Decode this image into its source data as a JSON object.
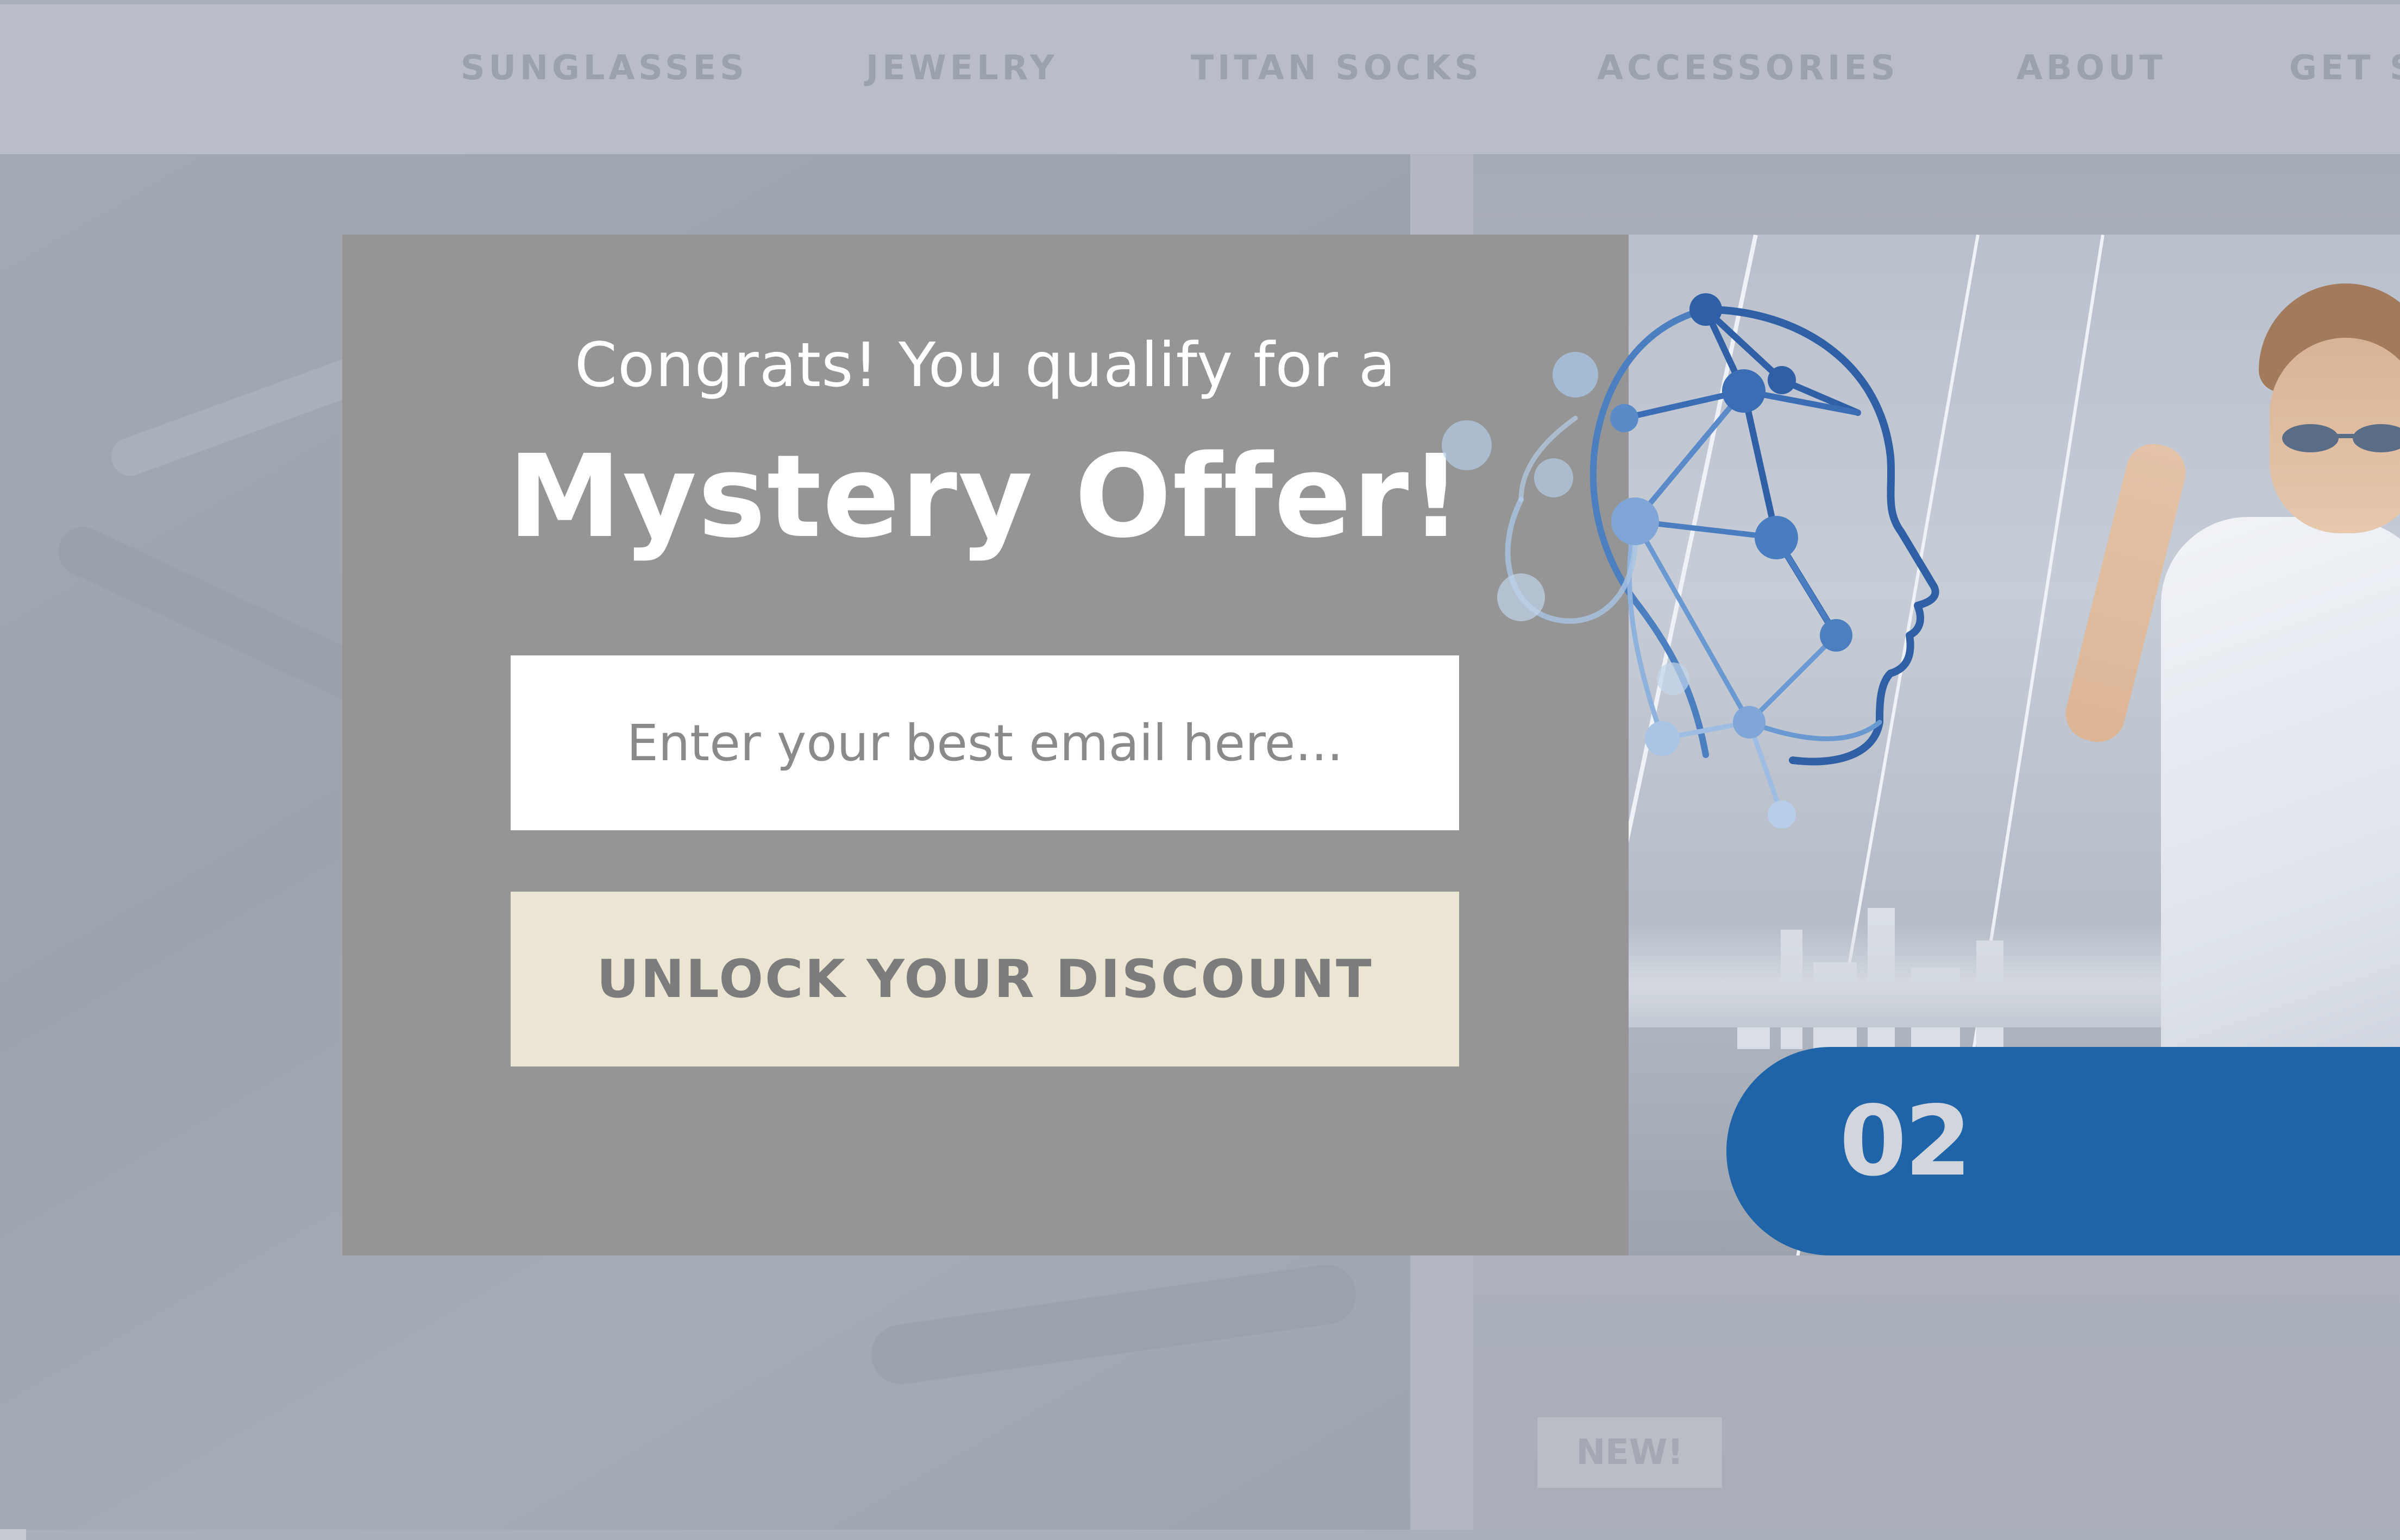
{
  "nav": {
    "items": [
      {
        "label": "SUNGLASSES"
      },
      {
        "label": "JEWELRY"
      },
      {
        "label": "TITAN SOCKS"
      },
      {
        "label": "ACCESSORIES"
      },
      {
        "label": "ABOUT"
      },
      {
        "label": "GET S"
      }
    ]
  },
  "product": {
    "badge": "NEW!"
  },
  "modal": {
    "subtitle": "Congrats! You qualify for a",
    "title": "Mystery Offer!",
    "email_placeholder": "Enter your best email here...",
    "cta_label": "UNLOCK YOUR DISCOUNT"
  },
  "promo": {
    "banner_number": "02",
    "logo_icon": "head-network-icon"
  },
  "colors": {
    "modal_bg": "#959595",
    "cta_bg": "#ebe5d3",
    "banner_blue": "#1f64a9",
    "logo_blue": "#2f5fa5",
    "overlay": "#a9afbb"
  }
}
